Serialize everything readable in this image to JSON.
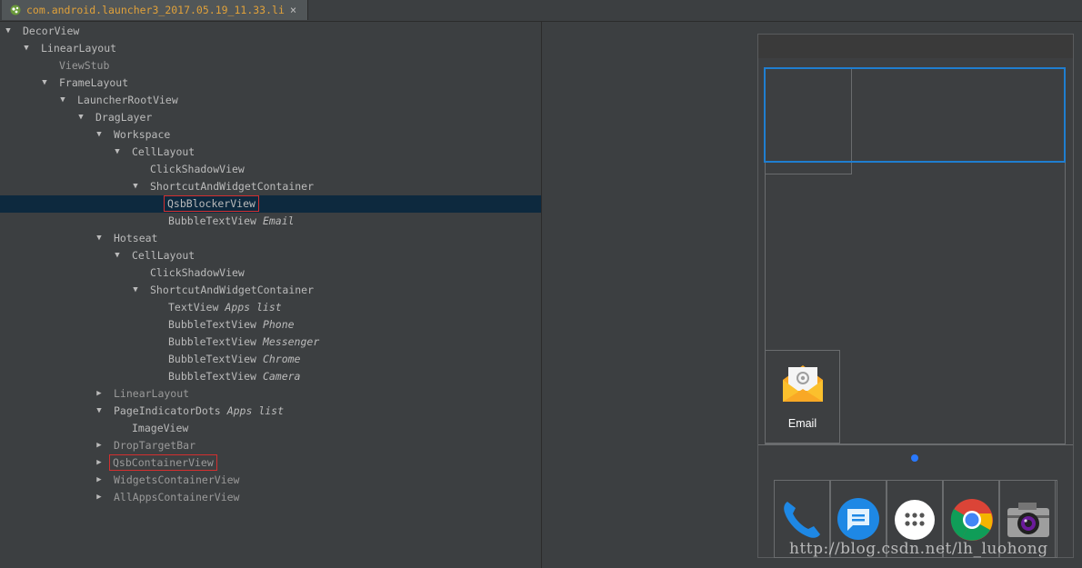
{
  "tab": {
    "title": "com.android.launcher3_2017.05.19_11.33.li",
    "close": "×"
  },
  "tree": [
    {
      "name": "DecorView",
      "desc": "",
      "arrow": "down",
      "dim": false,
      "selected": false,
      "boxed": false
    },
    {
      "name": "LinearLayout",
      "desc": "",
      "arrow": "down",
      "dim": false,
      "selected": false,
      "boxed": false
    },
    {
      "name": "ViewStub",
      "desc": "",
      "arrow": "none",
      "dim": true,
      "selected": false,
      "boxed": false
    },
    {
      "name": "FrameLayout",
      "desc": "",
      "arrow": "down",
      "dim": false,
      "selected": false,
      "boxed": false
    },
    {
      "name": "LauncherRootView",
      "desc": "",
      "arrow": "down",
      "dim": false,
      "selected": false,
      "boxed": false
    },
    {
      "name": "DragLayer",
      "desc": "",
      "arrow": "down",
      "dim": false,
      "selected": false,
      "boxed": false
    },
    {
      "name": "Workspace",
      "desc": "",
      "arrow": "down",
      "dim": false,
      "selected": false,
      "boxed": false
    },
    {
      "name": "CellLayout",
      "desc": "",
      "arrow": "down",
      "dim": false,
      "selected": false,
      "boxed": false
    },
    {
      "name": "ClickShadowView",
      "desc": "",
      "arrow": "none",
      "dim": false,
      "selected": false,
      "boxed": false
    },
    {
      "name": "ShortcutAndWidgetContainer",
      "desc": "",
      "arrow": "down",
      "dim": false,
      "selected": false,
      "boxed": false
    },
    {
      "name": "QsbBlockerView",
      "desc": "",
      "arrow": "none",
      "dim": false,
      "selected": true,
      "boxed": true
    },
    {
      "name": "BubbleTextView",
      "desc": "Email",
      "arrow": "none",
      "dim": false,
      "selected": false,
      "boxed": false
    },
    {
      "name": "Hotseat",
      "desc": "",
      "arrow": "down",
      "dim": false,
      "selected": false,
      "boxed": false
    },
    {
      "name": "CellLayout",
      "desc": "",
      "arrow": "down",
      "dim": false,
      "selected": false,
      "boxed": false
    },
    {
      "name": "ClickShadowView",
      "desc": "",
      "arrow": "none",
      "dim": false,
      "selected": false,
      "boxed": false
    },
    {
      "name": "ShortcutAndWidgetContainer",
      "desc": "",
      "arrow": "down",
      "dim": false,
      "selected": false,
      "boxed": false
    },
    {
      "name": "TextView",
      "desc": "Apps list",
      "arrow": "none",
      "dim": false,
      "selected": false,
      "boxed": false
    },
    {
      "name": "BubbleTextView",
      "desc": "Phone",
      "arrow": "none",
      "dim": false,
      "selected": false,
      "boxed": false
    },
    {
      "name": "BubbleTextView",
      "desc": "Messenger",
      "arrow": "none",
      "dim": false,
      "selected": false,
      "boxed": false
    },
    {
      "name": "BubbleTextView",
      "desc": "Chrome",
      "arrow": "none",
      "dim": false,
      "selected": false,
      "boxed": false
    },
    {
      "name": "BubbleTextView",
      "desc": "Camera",
      "arrow": "none",
      "dim": false,
      "selected": false,
      "boxed": false
    },
    {
      "name": "LinearLayout",
      "desc": "",
      "arrow": "right",
      "dim": true,
      "selected": false,
      "boxed": false
    },
    {
      "name": "PageIndicatorDots",
      "desc": "Apps list",
      "arrow": "down",
      "dim": false,
      "selected": false,
      "boxed": false
    },
    {
      "name": "ImageView",
      "desc": "",
      "arrow": "none",
      "dim": false,
      "selected": false,
      "boxed": false
    },
    {
      "name": "DropTargetBar",
      "desc": "",
      "arrow": "right",
      "dim": true,
      "selected": false,
      "boxed": false
    },
    {
      "name": "QsbContainerView",
      "desc": "",
      "arrow": "right",
      "dim": true,
      "selected": false,
      "boxed": true
    },
    {
      "name": "WidgetsContainerView",
      "desc": "",
      "arrow": "right",
      "dim": true,
      "selected": false,
      "boxed": false
    },
    {
      "name": "AllAppsContainerView",
      "desc": "",
      "arrow": "right",
      "dim": true,
      "selected": false,
      "boxed": false
    }
  ],
  "preview": {
    "email_label": "Email",
    "hotseat_icons": [
      "phone-icon",
      "messenger-icon",
      "apps-list-icon",
      "chrome-icon",
      "camera-icon"
    ],
    "watermark": "http://blog.csdn.net/lh_luohong",
    "accent": "#1f7ed0",
    "dot_color": "#2979ff"
  }
}
